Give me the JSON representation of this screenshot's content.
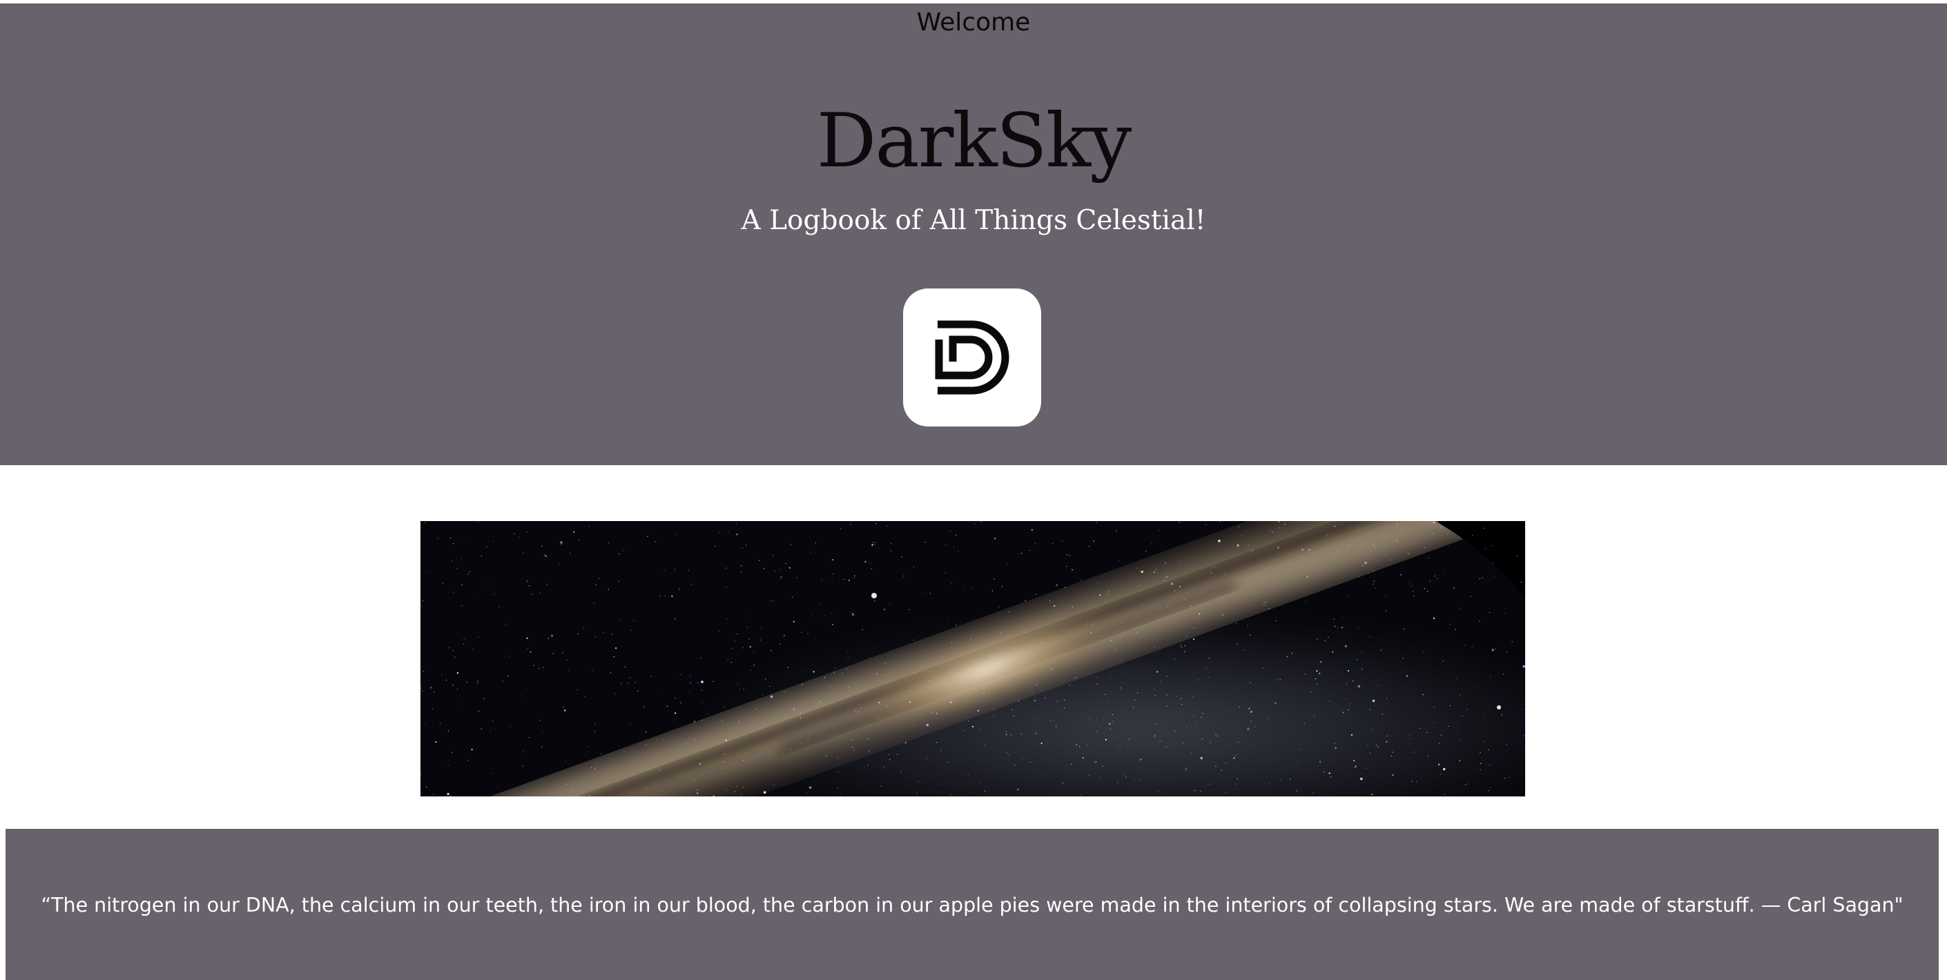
{
  "header": {
    "welcome": "Welcome",
    "brand_title": "DarkSky",
    "tagline": "A Logbook of All Things Celestial!",
    "logo": {
      "icon": "darksky-d-logo-icon",
      "tile_color": "#ffffff",
      "glyph_color": "#0a0a0a"
    }
  },
  "hero_image": {
    "subject": "milky-way-night-sky",
    "icon": "milky-way-image"
  },
  "footer": {
    "quote": "“The nitrogen in our DNA, the calcium in our teeth, the iron in our blood, the carbon in our apple pies were made in the interiors of collapsing stars. We are made of starstuff. — Carl Sagan\""
  },
  "colors": {
    "band": "#67626b",
    "page_background": "#ffffff",
    "title_text": "#0c0a0d",
    "light_text": "#ffffff"
  }
}
